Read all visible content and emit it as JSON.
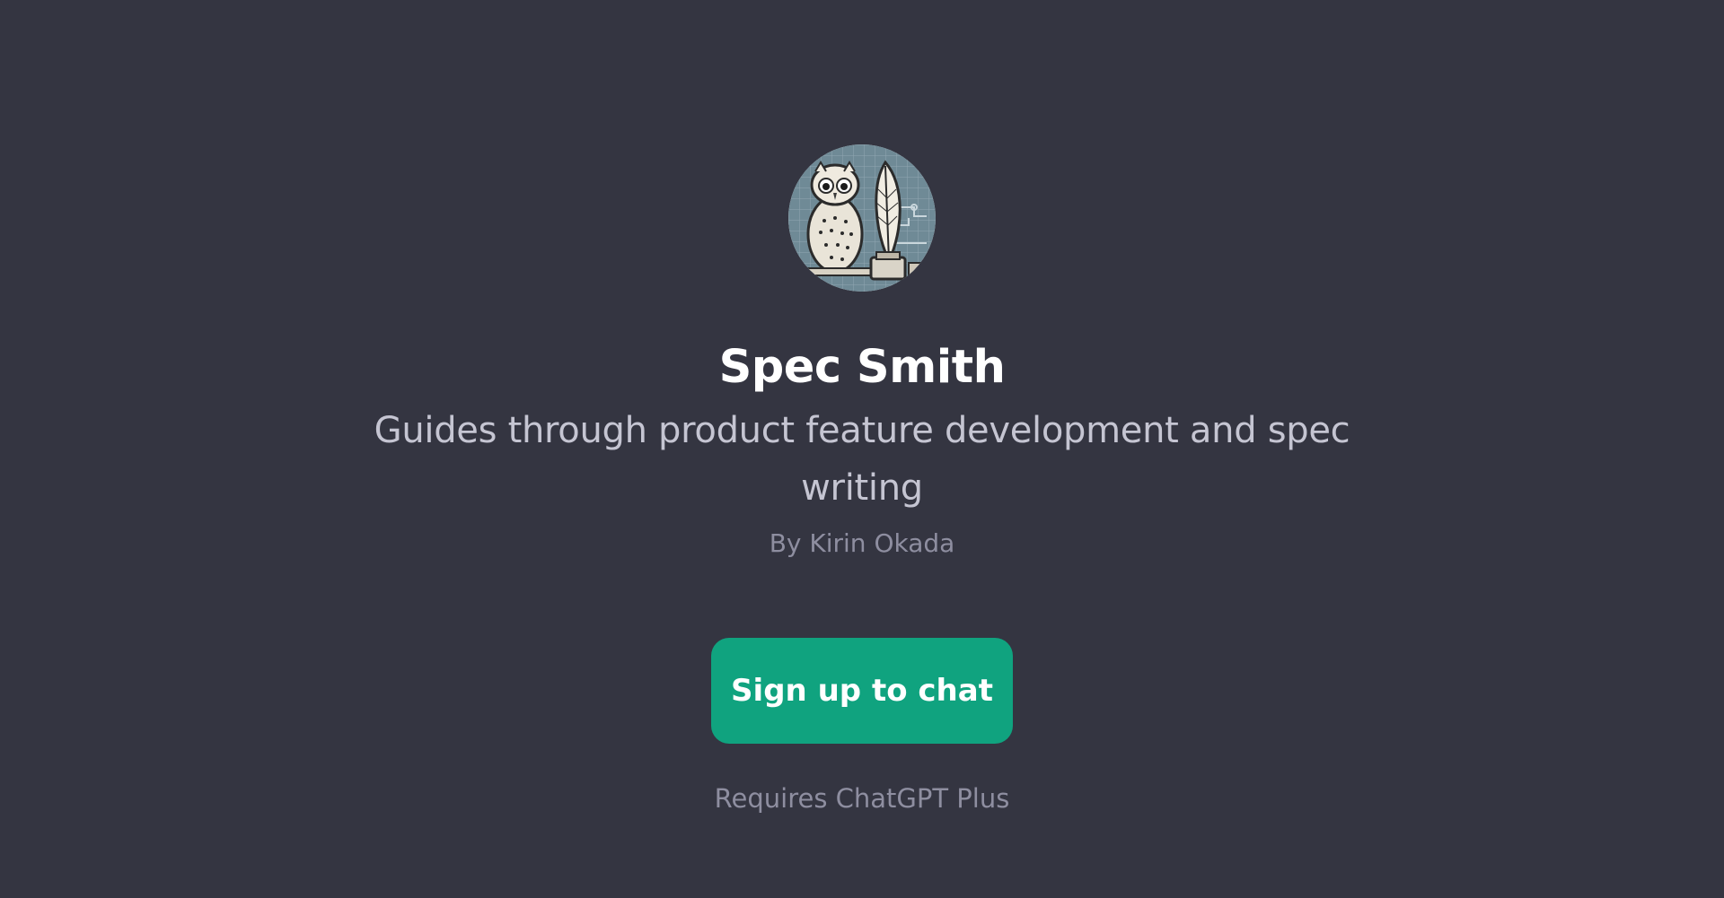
{
  "gpt": {
    "name": "Spec Smith",
    "description": "Guides through product feature development and spec writing",
    "author": "By Kirin Okada",
    "avatar_icon": "owl-quill-avatar"
  },
  "cta": {
    "label": "Sign up to chat"
  },
  "footer": {
    "requirement": "Requires ChatGPT Plus"
  },
  "colors": {
    "background": "#343541",
    "button": "#10a37f",
    "title": "#ffffff",
    "description": "#c5c5d2",
    "muted": "#8e8ea0"
  }
}
